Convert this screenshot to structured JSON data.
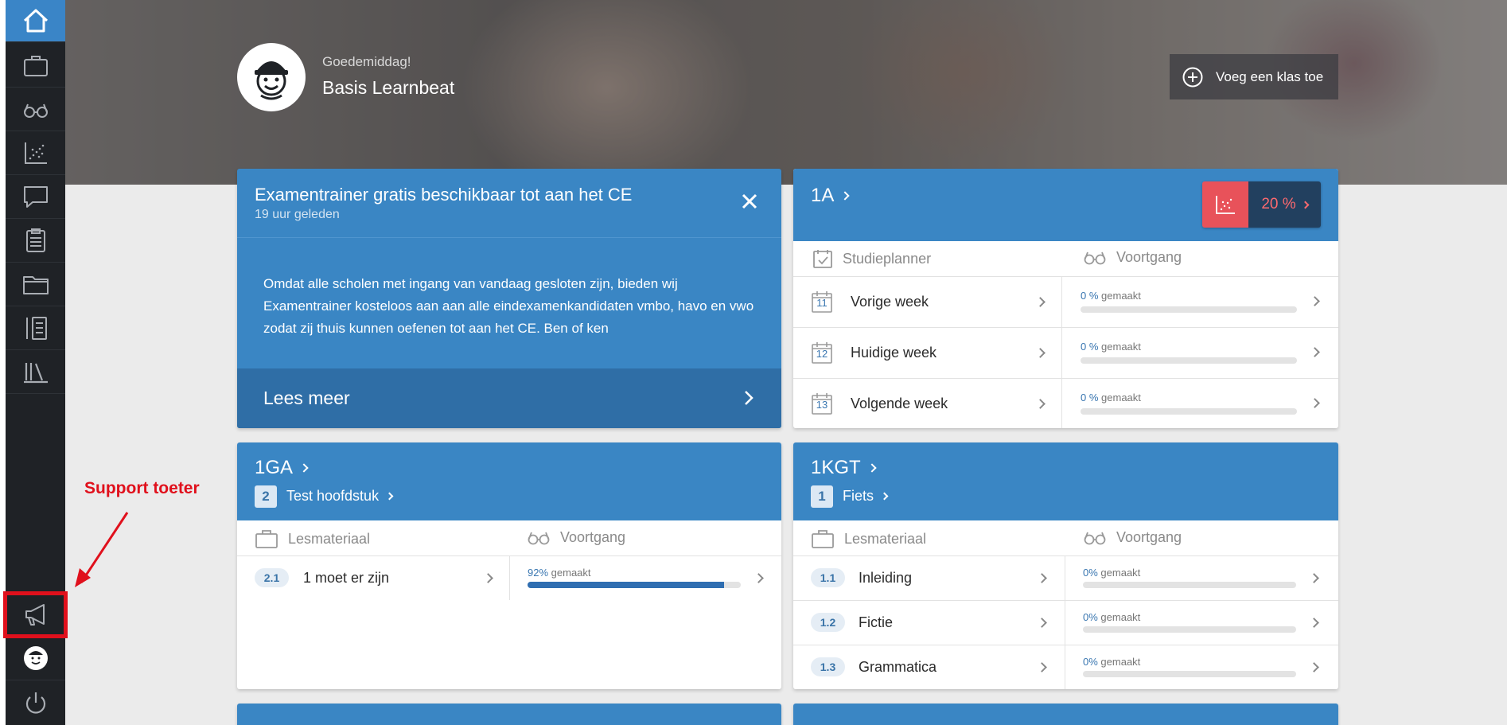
{
  "annotation": {
    "label": "Support toeter"
  },
  "header": {
    "greeting": "Goedemiddag!",
    "user_name": "Basis Learnbeat",
    "add_class_label": "Voeg een klas toe"
  },
  "news": {
    "title": "Examentrainer gratis beschikbaar tot aan het CE",
    "time": "19 uur geleden",
    "body": "Omdat alle scholen met ingang van vandaag gesloten zijn, bieden wij Examentrainer kosteloos aan aan alle eindexamenkandidaten vmbo, havo en vwo zodat zij thuis kunnen oefenen tot aan het CE. Ben of ken",
    "more_label": "Lees meer"
  },
  "class_1a": {
    "title": "1A",
    "stat_value": "20 %",
    "studieplanner_label": "Studieplanner",
    "voortgang_label": "Voortgang",
    "rows": [
      {
        "week_num": "11",
        "label": "Vorige week",
        "percent": "0 %",
        "suffix": "gemaakt",
        "progress": 0
      },
      {
        "week_num": "12",
        "label": "Huidige week",
        "percent": "0 %",
        "suffix": "gemaakt",
        "progress": 0
      },
      {
        "week_num": "13",
        "label": "Volgende week",
        "percent": "0 %",
        "suffix": "gemaakt",
        "progress": 0
      }
    ]
  },
  "class_1ga": {
    "title": "1GA",
    "chapter_num": "2",
    "chapter_title": "Test hoofdstuk",
    "lesmateriaal_label": "Lesmateriaal",
    "voortgang_label": "Voortgang",
    "rows": [
      {
        "code": "2.1",
        "label": "1 moet er zijn",
        "percent": "92%",
        "suffix": "gemaakt",
        "progress": 0.92
      }
    ]
  },
  "class_1kgt": {
    "title": "1KGT",
    "chapter_num": "1",
    "chapter_title": "Fiets",
    "lesmateriaal_label": "Lesmateriaal",
    "voortgang_label": "Voortgang",
    "rows": [
      {
        "code": "1.1",
        "label": "Inleiding",
        "percent": "0%",
        "suffix": "gemaakt",
        "progress": 0
      },
      {
        "code": "1.2",
        "label": "Fictie",
        "percent": "0%",
        "suffix": "gemaakt",
        "progress": 0
      },
      {
        "code": "1.3",
        "label": "Grammatica",
        "percent": "0%",
        "suffix": "gemaakt",
        "progress": 0
      }
    ]
  },
  "colors": {
    "primary": "#3a86c4",
    "sidebar": "#1f2226",
    "accent_red": "#e8525a",
    "annotation_red": "#e0101c"
  },
  "icons": [
    "home-icon",
    "briefcase-icon",
    "glasses-icon",
    "scatter-chart-icon",
    "chat-icon",
    "clipboard-icon",
    "folder-icon",
    "notebook-icon",
    "library-icon",
    "megaphone-icon",
    "avatar-icon",
    "power-icon"
  ]
}
